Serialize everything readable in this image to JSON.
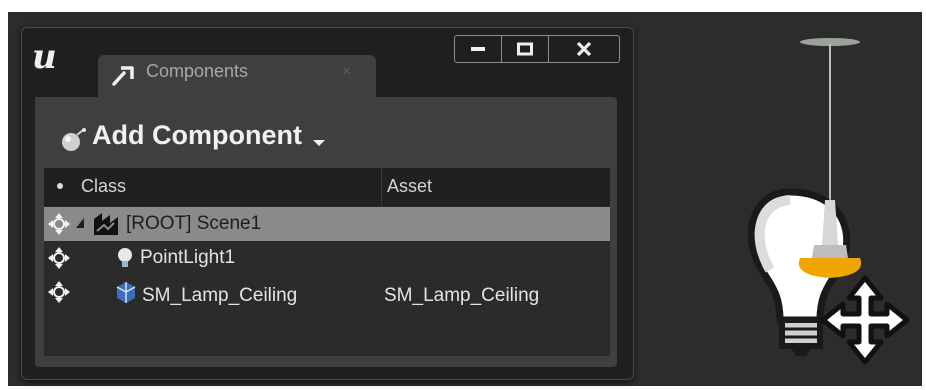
{
  "window": {
    "tab_label": "Components",
    "tab_close": "×"
  },
  "toolbar": {
    "add_component_label": "Add Component"
  },
  "tree": {
    "columns": [
      "Class",
      "Asset"
    ],
    "rows": [
      {
        "class": "[ROOT] Scene1",
        "asset": "",
        "icon": "scene-icon",
        "selected": true
      },
      {
        "class": "PointLight1",
        "asset": "",
        "icon": "point-light-icon",
        "selected": false
      },
      {
        "class": "SM_Lamp_Ceiling",
        "asset": "SM_Lamp_Ceiling",
        "icon": "static-mesh-icon",
        "selected": false
      }
    ]
  },
  "colors": {
    "panel": "#3f3f3f",
    "tree_bg": "#2b2b2b",
    "selected_row": "#8a8a8a",
    "lamp_base": "#f0a500"
  }
}
